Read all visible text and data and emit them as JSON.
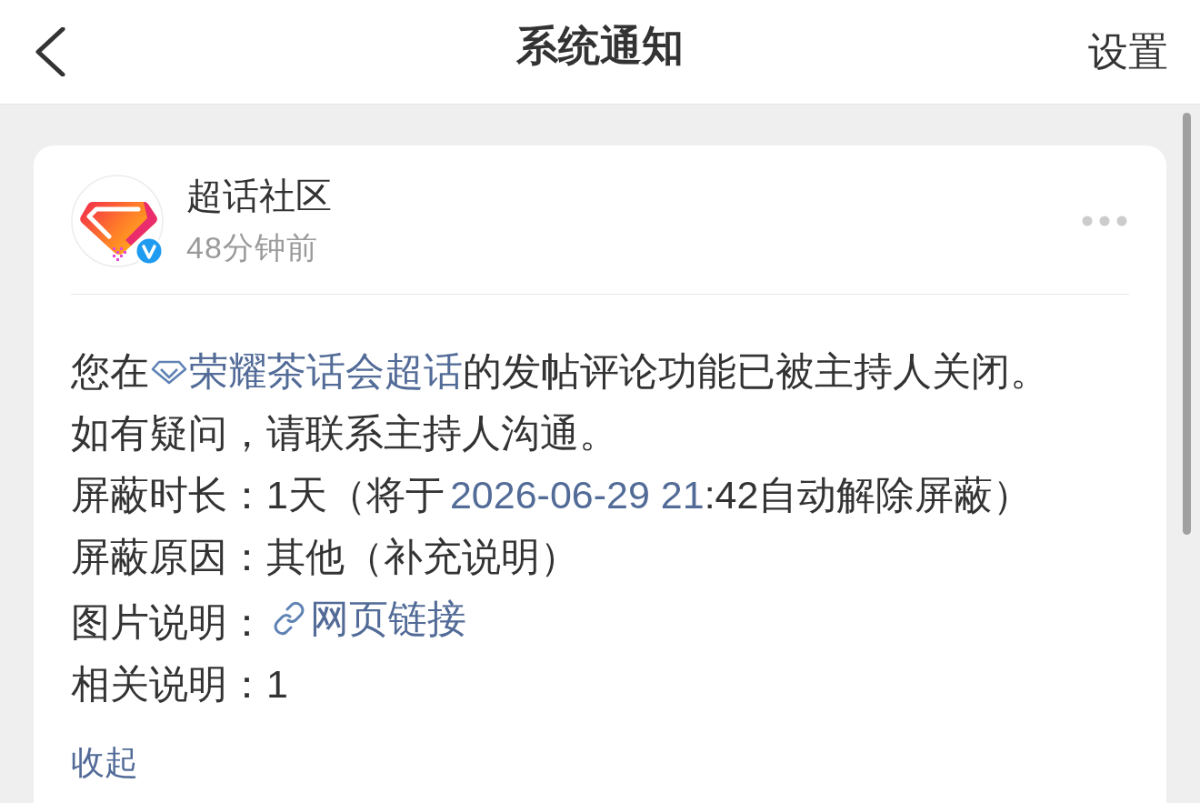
{
  "nav": {
    "title": "系统通知",
    "action": "设置"
  },
  "notification": {
    "sender": {
      "name": "超话社区",
      "verified": true
    },
    "time": "48分钟前",
    "message": {
      "before": "您在",
      "link": "荣耀茶话会超话",
      "after": "的发帖评论功能已被主持人关闭。"
    },
    "note": "如有疑问，请联系主持人沟通。",
    "details": [
      {
        "label": "屏蔽时长：",
        "parts": [
          {
            "kind": "text",
            "text": "1天（将于"
          },
          {
            "kind": "link",
            "text": "2026-06-29 21"
          },
          {
            "kind": "text",
            "text": ":42自动解除屏蔽）"
          }
        ]
      },
      {
        "label": "屏蔽原因：",
        "parts": [
          {
            "kind": "text",
            "text": "其他（补充说明）"
          }
        ]
      },
      {
        "label": "图片说明：",
        "parts": [
          {
            "kind": "web_link",
            "text": "网页链接"
          }
        ]
      },
      {
        "label": "相关说明：",
        "parts": [
          {
            "kind": "text",
            "text": "1"
          }
        ]
      }
    ],
    "collapse": "收起"
  }
}
